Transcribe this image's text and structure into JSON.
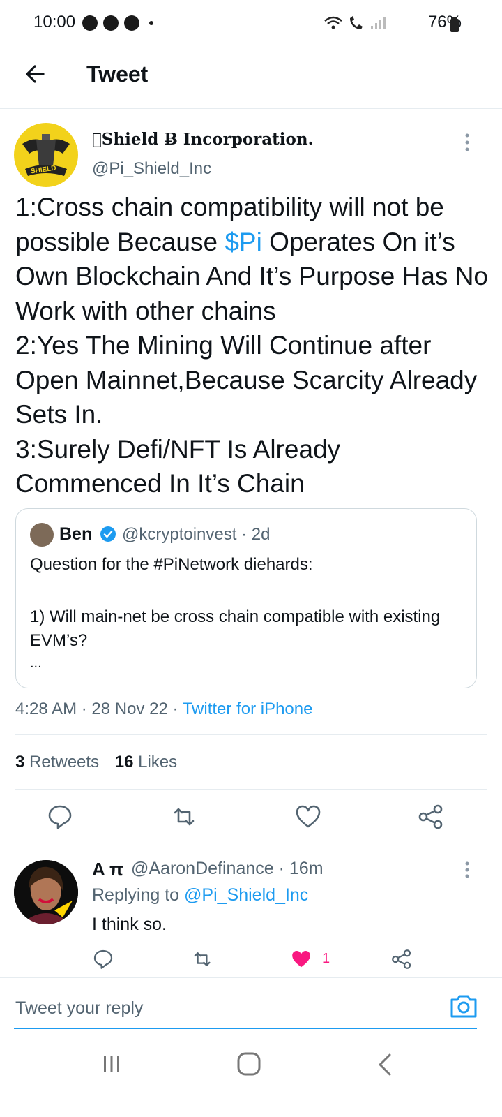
{
  "status_bar": {
    "time": "10:00",
    "battery": "76%",
    "left_icons": [
      "messenger-icon",
      "chrome-icon",
      "messenger-icon"
    ],
    "right_icons": [
      "wifi-icon",
      "wifi-calling-icon",
      "signal-icon",
      "battery-icon"
    ]
  },
  "header": {
    "title": "Tweet"
  },
  "tweet": {
    "display_name": "Shield Ƀ Incorporation.",
    "handle": "@Pi_Shield_Inc",
    "avatar_text": "SHIELD",
    "body": {
      "p1_before": "1:Cross chain compatibility will not be possible Because ",
      "p1_link": "$Pi",
      "p1_after": " Operates On it’s Own Blockchain And It’s Purpose Has No Work with other chains",
      "p2": "2:Yes The Mining Will Continue after Open Mainnet,Because Scarcity Already Sets In.",
      "p3": "3:Surely Defi/NFT Is Already Commenced In It’s Chain"
    },
    "quoted": {
      "name": "Ben",
      "handle_time": "@kcryptoinvest · 2d",
      "line1": "Question for the #PiNetwork diehards:",
      "line2": "1) Will main-net be cross chain compatible with existing EVM’s?",
      "ellipsis": "..."
    },
    "time": "4:28 AM",
    "date": "28 Nov 22",
    "client": "Twitter for iPhone",
    "retweets_count": "3",
    "retweets_label": "Retweets",
    "likes_count": "16",
    "likes_label": "Likes"
  },
  "reply": {
    "name": "A π",
    "handle_time": "@AaronDefinance · 16m",
    "replying_prefix": "Replying to ",
    "replying_handle": "@Pi_Shield_Inc",
    "text": "I think so.",
    "like_count": "1"
  },
  "composer": {
    "placeholder": "Tweet your reply"
  },
  "colors": {
    "accent": "#1d9bf0",
    "like": "#f91880",
    "muted": "#536471",
    "avatar_yellow": "#f2d21b"
  }
}
